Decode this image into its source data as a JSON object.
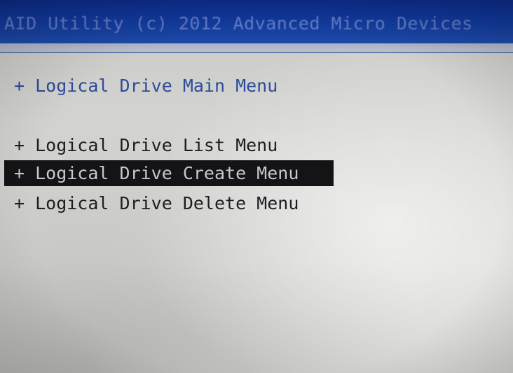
{
  "header": {
    "title": "AID Utility (c) 2012 Advanced Micro Devices"
  },
  "menu": {
    "main_title": "+ Logical Drive Main Menu",
    "items": [
      {
        "label": "+ Logical Drive List Menu",
        "selected": false
      },
      {
        "label": "+ Logical Drive Create Menu",
        "selected": true
      },
      {
        "label": "+ Logical Drive Delete Menu",
        "selected": false
      }
    ]
  },
  "colors": {
    "title_bar": "#123a9c",
    "title_text": "#6f86c8",
    "main_menu_text": "#2d4c9a",
    "menu_text": "#1e1e22",
    "selection_bg": "#141416",
    "selection_text": "#c8c8cc"
  }
}
